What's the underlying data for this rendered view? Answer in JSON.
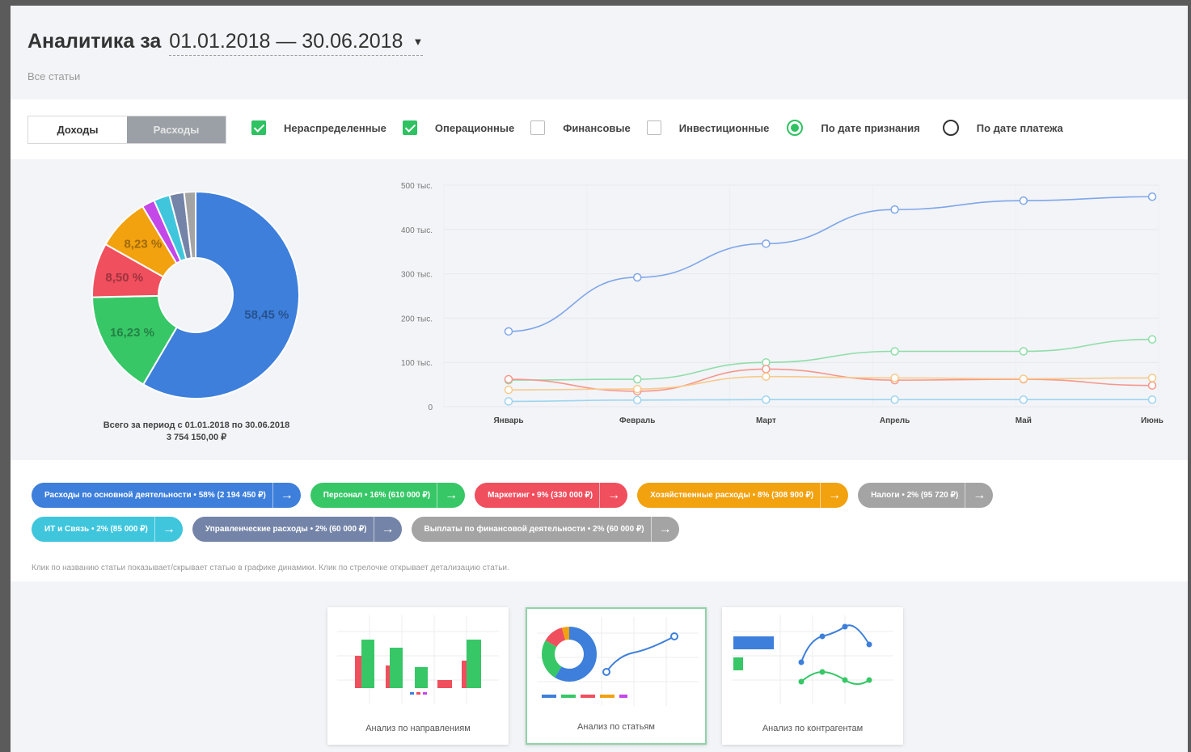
{
  "header": {
    "title": "Аналитика за",
    "date_range": "01.01.2018 — 30.06.2018",
    "subtitle": "Все статьи"
  },
  "toolbar": {
    "tabs": [
      {
        "label": "Доходы",
        "active": false
      },
      {
        "label": "Расходы",
        "active": true
      }
    ],
    "checkboxes": [
      {
        "label": "Нераспределенные",
        "checked": true
      },
      {
        "label": "Операционные",
        "checked": true
      },
      {
        "label": "Финансовые",
        "checked": false
      },
      {
        "label": "Инвестиционные",
        "checked": false
      }
    ],
    "radios": [
      {
        "label": "По дате признания",
        "checked": true
      },
      {
        "label": "По дате платежа",
        "checked": false
      }
    ]
  },
  "total": {
    "line1": "Всего за период с 01.01.2018 по 30.06.2018",
    "line2": "3 754 150,00 ₽"
  },
  "chart_data": [
    {
      "type": "pie",
      "variant": "donut",
      "slices": [
        {
          "label": "Расходы по основной деятельности",
          "value": 58.45,
          "display": "58,45 %",
          "color": "#3d7fdb"
        },
        {
          "label": "Персонал",
          "value": 16.23,
          "display": "16,23 %",
          "color": "#37c767"
        },
        {
          "label": "Маркетинг",
          "value": 8.5,
          "display": "8,50 %",
          "color": "#f04f5e"
        },
        {
          "label": "Хозяйственные расходы",
          "value": 8.23,
          "display": "8,23 %",
          "color": "#f2a10f"
        },
        {
          "label": "Налоги",
          "value": 2.0,
          "display": "",
          "color": "#c447e8"
        },
        {
          "label": "ИТ и Связь",
          "value": 2.5,
          "display": "",
          "color": "#3fc6dd"
        },
        {
          "label": "Управленческие расходы",
          "value": 2.3,
          "display": "",
          "color": "#7484a8"
        },
        {
          "label": "Выплаты по финансовой деятельности",
          "value": 1.79,
          "display": "",
          "color": "#a4a4a4"
        }
      ]
    },
    {
      "type": "line",
      "categories": [
        "Январь",
        "Февраль",
        "Март",
        "Апрель",
        "Май",
        "Июнь"
      ],
      "ylim": [
        0,
        500000
      ],
      "yticks": [
        {
          "value": 0,
          "label": "0"
        },
        {
          "value": 100000,
          "label": "100 тыс."
        },
        {
          "value": 200000,
          "label": "200 тыс."
        },
        {
          "value": 300000,
          "label": "300 тыс."
        },
        {
          "value": 400000,
          "label": "400 тыс."
        },
        {
          "value": 500000,
          "label": "500 тыс."
        }
      ],
      "grid": true,
      "series": [
        {
          "values": [
            170000,
            292000,
            368000,
            445000,
            465000,
            474000
          ],
          "color": "#7fa6ea"
        },
        {
          "values": [
            60000,
            62000,
            100000,
            125000,
            125000,
            152000
          ],
          "color": "#8fdda9"
        },
        {
          "values": [
            62000,
            35000,
            85000,
            60000,
            62000,
            48000
          ],
          "color": "#f6978d"
        },
        {
          "values": [
            38000,
            40000,
            68000,
            65000,
            63000,
            65000
          ],
          "color": "#f8c98b"
        },
        {
          "values": [
            12000,
            15000,
            16000,
            16000,
            16000,
            16000
          ],
          "color": "#9fd4ef"
        }
      ]
    }
  ],
  "legend": {
    "row1": [
      {
        "label": "Расходы по основной деятельности • 58% (2 194 450 ₽)",
        "color": "#3d7fdb"
      },
      {
        "label": "Персонал • 16% (610 000 ₽)",
        "color": "#37c767"
      },
      {
        "label": "Маркетинг • 9% (330 000 ₽)",
        "color": "#f04f5e"
      },
      {
        "label": "Хозяйственные расходы • 8% (308 900 ₽)",
        "color": "#f2a10f"
      },
      {
        "label": "Налоги • 2% (95 720 ₽)",
        "color": "#a4a4a4"
      }
    ],
    "row2": [
      {
        "label": "ИТ и Связь • 2% (85 000 ₽)",
        "color": "#3fc6dd"
      },
      {
        "label": "Управленческие расходы • 2% (60 000 ₽)",
        "color": "#7484a8"
      },
      {
        "label": "Выплаты по финансовой деятельности • 2% (60 000 ₽)",
        "color": "#a4a4a4"
      }
    ],
    "hint": "Клик по названию статьи показывает/скрывает статью в графике динамики. Клик по стрелочке открывает детализацию статьи."
  },
  "cards": [
    {
      "label": "Анализ по направлениям",
      "selected": false
    },
    {
      "label": "Анализ по статьям",
      "selected": true
    },
    {
      "label": "Анализ по контрагентам",
      "selected": false
    }
  ]
}
